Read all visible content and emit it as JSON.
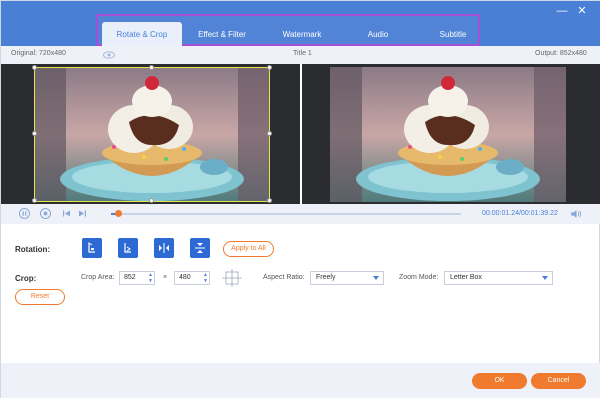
{
  "window": {
    "minimize_glyph": "—",
    "close_glyph": "✕"
  },
  "tabs": [
    {
      "label": "Rotate & Crop",
      "active": true
    },
    {
      "label": "Effect & Filter",
      "active": false
    },
    {
      "label": "Watermark",
      "active": false
    },
    {
      "label": "Audio",
      "active": false
    },
    {
      "label": "Subtitle",
      "active": false
    }
  ],
  "infobar": {
    "original": "Original: 720x480",
    "title": "Title 1",
    "output": "Output: 852x480"
  },
  "playback": {
    "time": "00:00:01.24/00:01:39.22",
    "progress": 0.02
  },
  "rotation": {
    "label": "Rotation:",
    "apply_all": "Apply to All"
  },
  "crop": {
    "label": "Crop:",
    "area_label": "Crop Area:",
    "width": "852",
    "times": "×",
    "height": "480",
    "aspect_label": "Aspect Ratio:",
    "aspect_value": "Freely",
    "zoom_label": "Zoom Mode:",
    "zoom_value": "Letter Box",
    "reset": "Reset"
  },
  "footer": {
    "ok": "OK",
    "cancel": "Cancel"
  },
  "colors": {
    "accent_blue": "#4a7fd6",
    "accent_orange": "#f07a2e",
    "highlight_purple": "#a34fd6"
  }
}
